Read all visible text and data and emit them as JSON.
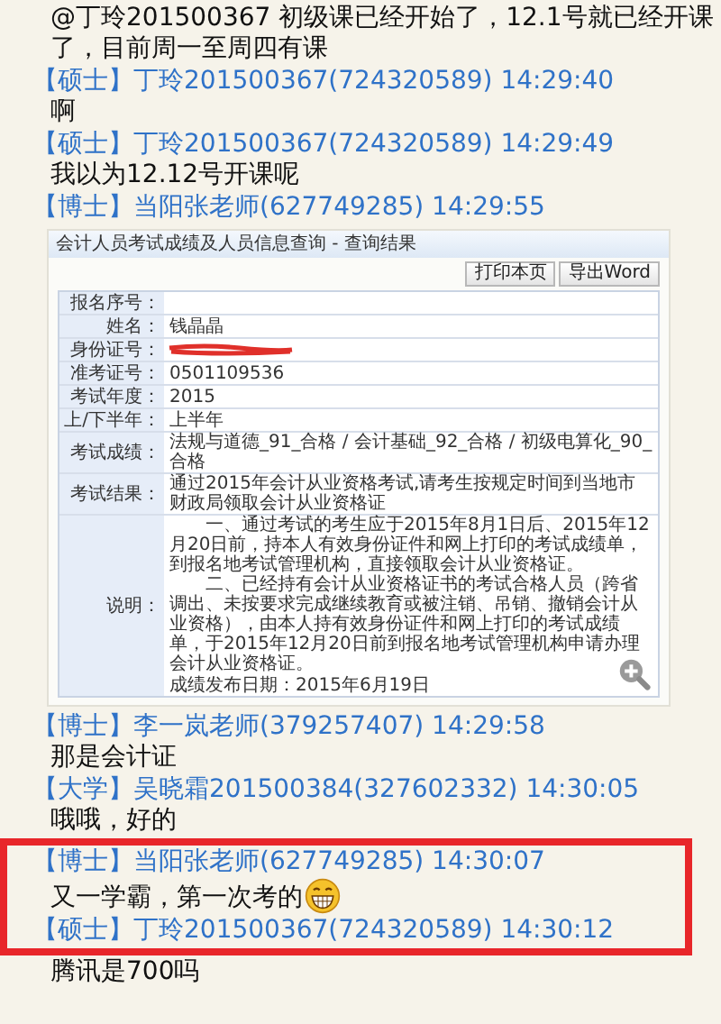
{
  "messages": [
    {
      "kind": "text",
      "text": "@丁玲201500367 初级课已经开始了，12.1号就已经开课了，目前周一至周四有课",
      "highlighted": false
    },
    {
      "kind": "header",
      "text": "【硕士】丁玲201500367(724320589) 14:29:40",
      "highlighted": false
    },
    {
      "kind": "text",
      "text": "啊",
      "highlighted": false
    },
    {
      "kind": "header",
      "text": "【硕士】丁玲201500367(724320589) 14:29:49",
      "highlighted": false
    },
    {
      "kind": "text",
      "text": "我以为12.12号开课呢",
      "highlighted": false
    },
    {
      "kind": "header",
      "text": "【博士】当阳张老师(627749285) 14:29:55",
      "highlighted": false
    },
    {
      "kind": "image",
      "highlighted": false,
      "shot": {
        "title": "会计人员考试成绩及人员信息查询 - 查询结果",
        "buttons": [
          "打印本页",
          "导出Word"
        ],
        "rows": [
          {
            "label": "报名序号："
          },
          {
            "label": "姓名：",
            "value": "钱晶晶"
          },
          {
            "label": "身份证号：",
            "redacted": true
          },
          {
            "label": "准考证号：",
            "value": "0501109536"
          },
          {
            "label": "考试年度：",
            "value": "2015"
          },
          {
            "label": "上/下半年：",
            "value": "上半年"
          },
          {
            "label": "考试成绩：",
            "value": "法规与道德_91_合格 / 会计基础_92_合格 / 初级电算化_90_合格"
          },
          {
            "label": "考试结果：",
            "value": "通过2015年会计从业资格考试,请考生按规定时间到当地市财政局领取会计从业资格证"
          },
          {
            "label": "说明：",
            "paragraphs": [
              "一、通过考试的考生应于2015年8月1日后、2015年12月20日前，持本人有效身份证件和网上打印的考试成绩单，到报名地考试管理机构，直接领取会计从业资格证。",
              "二、已经持有会计从业资格证书的考试合格人员（跨省调出、未按要求完成继续教育或被注销、吊销、撤销会计从业资格），由本人持有效身份证件和网上打印的考试成绩单，于2015年12月20日前到报名地考试管理机构申请办理会计从业资格证。",
              "成绩发布日期：2015年6月19日"
            ]
          }
        ]
      }
    },
    {
      "kind": "header",
      "text": "【博士】李一岚老师(379257407) 14:29:58",
      "highlighted": false
    },
    {
      "kind": "text",
      "text": "那是会计证",
      "highlighted": false
    },
    {
      "kind": "header",
      "text": "【大学】吴晓霜201500384(327602332) 14:30:05",
      "highlighted": false
    },
    {
      "kind": "text",
      "text": "哦哦，好的",
      "highlighted": false
    },
    {
      "kind": "header",
      "text": "【博士】当阳张老师(627749285) 14:30:07",
      "highlighted": true
    },
    {
      "kind": "emoji",
      "text": "又一学霸，第一次考的",
      "highlighted": true
    },
    {
      "kind": "header",
      "text": "【硕士】丁玲201500367(724320589) 14:30:12",
      "highlighted": true
    },
    {
      "kind": "text",
      "text": "腾讯是700吗",
      "highlighted": false
    }
  ]
}
